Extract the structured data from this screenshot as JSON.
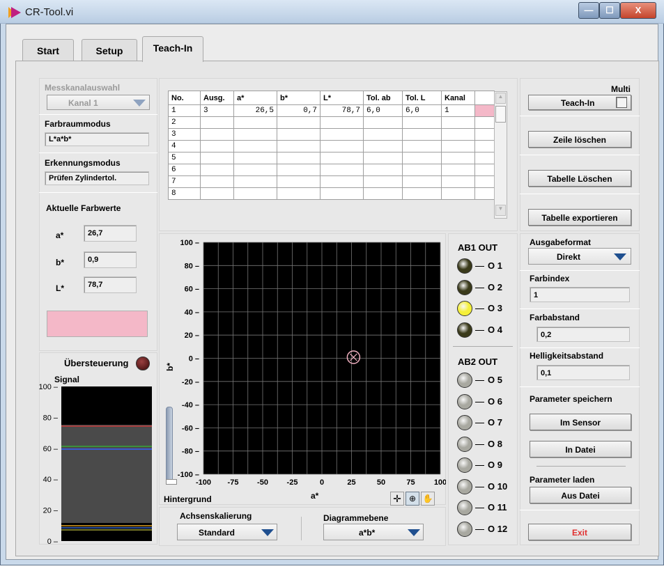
{
  "window": {
    "title": "CR-Tool.vi",
    "min": "—",
    "max": "☐",
    "close": "X"
  },
  "tabs": [
    {
      "label": "Start"
    },
    {
      "label": "Setup"
    },
    {
      "label": "Teach-In"
    }
  ],
  "left": {
    "messkanal_label": "Messkanalauswahl",
    "messkanal_value": "Kanal 1",
    "farbraum_label": "Farbraummodus",
    "farbraum_value": "L*a*b*",
    "erkennung_label": "Erkennungsmodus",
    "erkennung_value": "Prüfen Zylindertol.",
    "aktuelle_label": "Aktuelle Farbwerte",
    "a_label": "a*",
    "a_value": "26,7",
    "b_label": "b*",
    "b_value": "0,9",
    "l_label": "L*",
    "l_value": "78,7",
    "color_swatch": "#f4b8c8",
    "uebersteuerung_label": "Übersteuerung",
    "signal_label": "Signal",
    "signal_ticks": [
      "100",
      "80",
      "60",
      "40",
      "20",
      "0"
    ]
  },
  "table": {
    "headers": [
      "No.",
      "Ausg.",
      "a*",
      "b*",
      "L*",
      "Tol. ab",
      "Tol. L",
      "Kanal",
      ""
    ],
    "rows": [
      [
        "1",
        "3",
        "26,5",
        "0,7",
        "78,7",
        "6,0",
        "6,0",
        "1"
      ],
      [
        "2",
        "",
        "",
        "",
        "",
        "",
        "",
        ""
      ],
      [
        "3",
        "",
        "",
        "",
        "",
        "",
        "",
        ""
      ],
      [
        "4",
        "",
        "",
        "",
        "",
        "",
        "",
        ""
      ],
      [
        "5",
        "",
        "",
        "",
        "",
        "",
        "",
        ""
      ],
      [
        "6",
        "",
        "",
        "",
        "",
        "",
        "",
        ""
      ],
      [
        "7",
        "",
        "",
        "",
        "",
        "",
        "",
        ""
      ],
      [
        "8",
        "",
        "",
        "",
        "",
        "",
        "",
        ""
      ]
    ],
    "row1_color": "#f4b8c8"
  },
  "plot": {
    "ylabel": "b*",
    "xlabel": "a*",
    "y_ticks": [
      "100",
      "80",
      "60",
      "40",
      "20",
      "0",
      "-20",
      "-40",
      "-60",
      "-80",
      "-100"
    ],
    "x_ticks": [
      "-100",
      "-75",
      "-50",
      "-25",
      "0",
      "25",
      "50",
      "75",
      "100"
    ],
    "marker_a": 26.7,
    "marker_b": 0.9,
    "hintergrund_label": "Hintergrund",
    "achsen_label": "Achsenskalierung",
    "achsen_value": "Standard",
    "ebene_label": "Diagrammebene",
    "ebene_value": "a*b*"
  },
  "outputs": {
    "ab1_label": "AB1 OUT",
    "ab2_label": "AB2 OUT",
    "items": [
      {
        "label": "O 1",
        "color": "#3a3a1a"
      },
      {
        "label": "O 2",
        "color": "#3a3a1a"
      },
      {
        "label": "O 3",
        "color": "#f5f03a"
      },
      {
        "label": "O 4",
        "color": "#3a3a1a"
      },
      {
        "label": "O 5",
        "color": "#a8a8a0"
      },
      {
        "label": "O 6",
        "color": "#a8a8a0"
      },
      {
        "label": "O 7",
        "color": "#a8a8a0"
      },
      {
        "label": "O 8",
        "color": "#a8a8a0"
      },
      {
        "label": "O 9",
        "color": "#a8a8a0"
      },
      {
        "label": "O 10",
        "color": "#a8a8a0"
      },
      {
        "label": "O 11",
        "color": "#a8a8a0"
      },
      {
        "label": "O 12",
        "color": "#a8a8a0"
      }
    ]
  },
  "right": {
    "multi_label": "Multi",
    "teachin_button": "Teach-In",
    "zeile_button": "Zeile löschen",
    "tabelle_loeschen_button": "Tabelle Löschen",
    "tabelle_export_button": "Tabelle exportieren",
    "ausgabe_label": "Ausgabeformat",
    "ausgabe_value": "Direkt",
    "farbindex_label": "Farbindex",
    "farbindex_value": "1",
    "farbabstand_label": "Farbabstand",
    "farbabstand_value": "0,2",
    "helligkeit_label": "Helligkeitsabstand",
    "helligkeit_value": "0,1",
    "param_speichern_label": "Parameter speichern",
    "im_sensor_button": "Im Sensor",
    "in_datei_button": "In Datei",
    "param_laden_label": "Parameter laden",
    "aus_datei_button": "Aus Datei",
    "exit_button": "Exit"
  }
}
